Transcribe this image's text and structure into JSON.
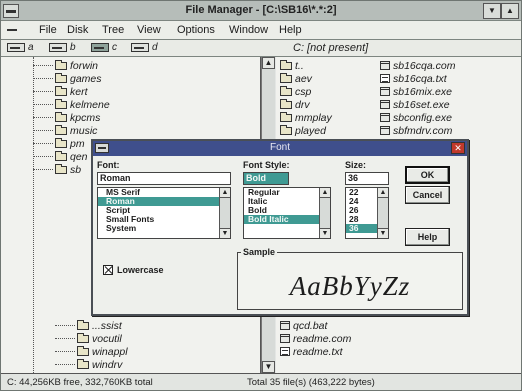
{
  "window": {
    "title": "File Manager - [C:\\SB16\\*.*:2]",
    "minimize_glyph": "▼",
    "maximize_glyph": "▲"
  },
  "menubar": {
    "items": [
      "File",
      "Disk",
      "Tree",
      "View",
      "Options",
      "Window",
      "Help"
    ]
  },
  "drives": {
    "items": [
      {
        "letter": "a",
        "selected": false
      },
      {
        "letter": "b",
        "selected": false
      },
      {
        "letter": "c",
        "selected": true
      },
      {
        "letter": "d",
        "selected": false
      }
    ],
    "path_label": "C: [not present]"
  },
  "tree": {
    "items": [
      {
        "name": "forwin"
      },
      {
        "name": "games"
      },
      {
        "name": "kert"
      },
      {
        "name": "kelmene"
      },
      {
        "name": "kpcms"
      },
      {
        "name": "music"
      },
      {
        "name": "pm"
      },
      {
        "name": "qen"
      },
      {
        "name": "sb"
      },
      {
        "name": "...ssist"
      },
      {
        "name": "vocutil"
      },
      {
        "name": "winappl"
      },
      {
        "name": "windrv"
      }
    ]
  },
  "files": {
    "left_col": [
      {
        "name": "t..",
        "kind": "up"
      },
      {
        "name": "aev",
        "kind": "folder"
      },
      {
        "name": "csp",
        "kind": "folder"
      },
      {
        "name": "drv",
        "kind": "folder"
      },
      {
        "name": "mmplay",
        "kind": "folder"
      },
      {
        "name": "played",
        "kind": "folder"
      }
    ],
    "right_col": [
      {
        "name": "sb16cqa.com",
        "kind": "exe"
      },
      {
        "name": "sb16cqa.txt",
        "kind": "doc"
      },
      {
        "name": "sb16mix.exe",
        "kind": "exe"
      },
      {
        "name": "sb16set.exe",
        "kind": "exe"
      },
      {
        "name": "sbconfig.exe",
        "kind": "exe"
      },
      {
        "name": "sbfmdrv.com",
        "kind": "exe"
      }
    ],
    "bottom": [
      {
        "name": "qcd.bat",
        "kind": "exe"
      },
      {
        "name": "readme.com",
        "kind": "exe"
      },
      {
        "name": "readme.txt",
        "kind": "doc"
      }
    ]
  },
  "status": {
    "left": "C: 44,256KB free, 332,760KB total",
    "right": "Total 35 file(s) (463,222 bytes)"
  },
  "font_dialog": {
    "title": "Font",
    "close_glyph": "✕",
    "font_label": "Font:",
    "font_value": "Roman",
    "font_list": [
      "MS Serif",
      "Roman",
      "Script",
      "Small Fonts",
      "System"
    ],
    "font_selected": "Roman",
    "style_label": "Font Style:",
    "style_value": "Bold Italic",
    "style_list": [
      "Regular",
      "Italic",
      "Bold",
      "Bold Italic"
    ],
    "style_selected": "Bold Italic",
    "size_label": "Size:",
    "size_value": "36",
    "size_list": [
      "22",
      "24",
      "26",
      "28",
      "36"
    ],
    "size_selected": "36",
    "ok_label": "OK",
    "cancel_label": "Cancel",
    "help_label": "Help",
    "lowercase_label": "Lowercase",
    "lowercase_checked": true,
    "sample_label": "Sample",
    "sample_text": "AaBbYyZz"
  },
  "colors": {
    "dialog_title_bg": "#3f4f8c",
    "selection": "#3f9a93"
  }
}
